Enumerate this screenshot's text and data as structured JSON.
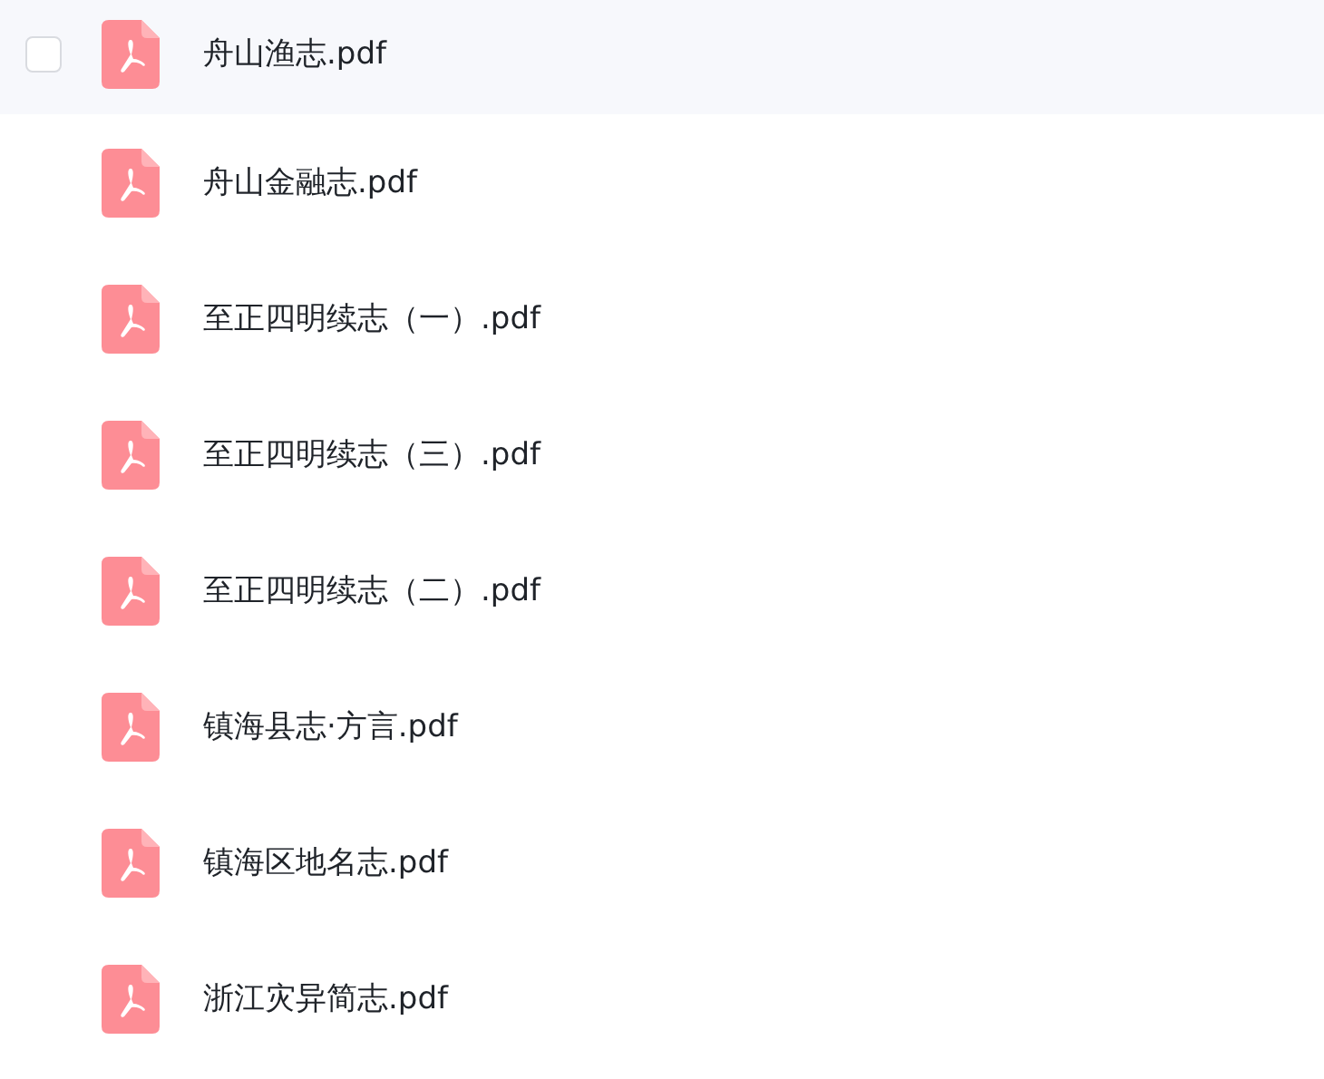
{
  "files": [
    {
      "name": "舟山渔志.pdf",
      "hovered": true
    },
    {
      "name": "舟山金融志.pdf",
      "hovered": false
    },
    {
      "name": "至正四明续志（一）.pdf",
      "hovered": false
    },
    {
      "name": "至正四明续志（三）.pdf",
      "hovered": false
    },
    {
      "name": "至正四明续志（二）.pdf",
      "hovered": false
    },
    {
      "name": "镇海县志·方言.pdf",
      "hovered": false
    },
    {
      "name": "镇海区地名志.pdf",
      "hovered": false
    },
    {
      "name": "浙江灾异简志.pdf",
      "hovered": false
    }
  ]
}
